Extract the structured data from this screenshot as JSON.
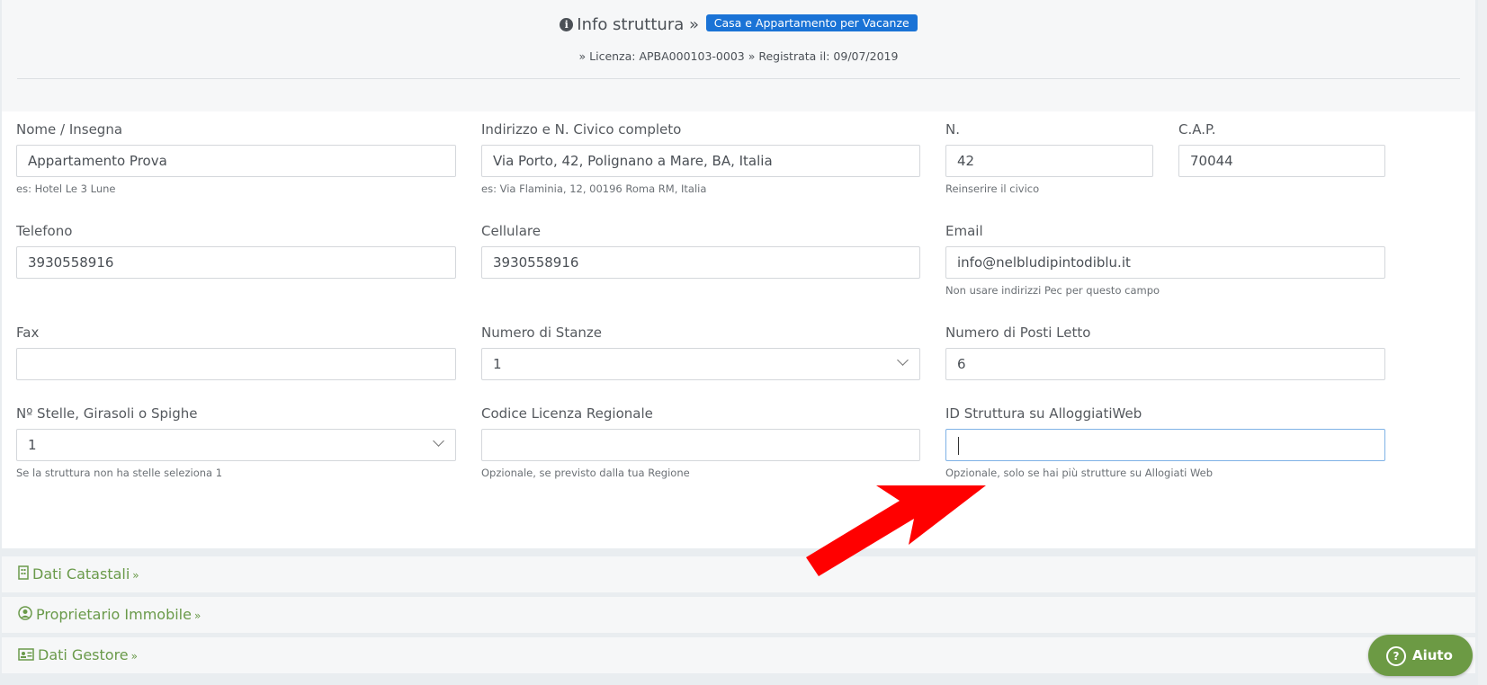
{
  "header": {
    "title": "Info struttura »",
    "badge": "Casa e Appartamento per Vacanze",
    "subtitle": "» Licenza: APBA000103-0003 » Registrata il: 09/07/2019"
  },
  "form": {
    "nome": {
      "label": "Nome / Insegna",
      "value": "Appartamento Prova",
      "help": "es: Hotel Le 3 Lune"
    },
    "indirizzo": {
      "label": "Indirizzo e N. Civico completo",
      "value": "Via Porto, 42, Polignano a Mare, BA, Italia",
      "help": "es: Via Flaminia, 12, 00196 Roma RM, Italia"
    },
    "numero": {
      "label": "N.",
      "value": "42",
      "help": "Reinserire il civico"
    },
    "cap": {
      "label": "C.A.P.",
      "value": "70044"
    },
    "telefono": {
      "label": "Telefono",
      "value": "3930558916"
    },
    "cellulare": {
      "label": "Cellulare",
      "value": "3930558916"
    },
    "email": {
      "label": "Email",
      "value": "info@nelbludipintodiblu.it",
      "help": "Non usare indirizzi Pec per questo campo"
    },
    "fax": {
      "label": "Fax",
      "value": ""
    },
    "stanze": {
      "label": "Numero di Stanze",
      "value": "1"
    },
    "posti_letto": {
      "label": "Numero di Posti Letto",
      "value": "6"
    },
    "stelle": {
      "label": "Nº Stelle, Girasoli o Spighe",
      "value": "1",
      "help": "Se la struttura non ha stelle seleziona 1"
    },
    "codice_licenza": {
      "label": "Codice Licenza Regionale",
      "value": "",
      "help": "Opzionale, se previsto dalla tua Regione"
    },
    "id_alloggiati": {
      "label": "ID Struttura su AlloggiatiWeb",
      "value": "",
      "help": "Opzionale, solo se hai più strutture su Allogiati Web"
    }
  },
  "sections": [
    {
      "label": "Dati Catastali",
      "icon": "building-icon"
    },
    {
      "label": "Proprietario Immobile",
      "icon": "user-circle-icon"
    },
    {
      "label": "Dati Gestore",
      "icon": "id-card-icon"
    }
  ],
  "help_button": {
    "label": "Aiuto",
    "icon": "question-circle-icon"
  },
  "colors": {
    "accent_blue": "#1a73d6",
    "section_green": "#6a9a4a",
    "help_green": "#6c9a44",
    "arrow_red": "#ff0000"
  }
}
